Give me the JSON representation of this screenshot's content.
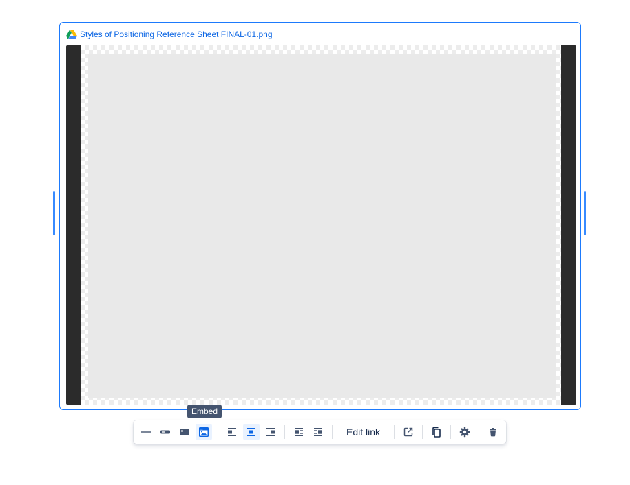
{
  "embed": {
    "title": "Styles of Positioning Reference Sheet FINAL-01.png",
    "provider_icon": "google-drive-icon"
  },
  "tooltip": {
    "text": "Embed"
  },
  "toolbar": {
    "view_buttons": [
      {
        "icon": "url-view-icon",
        "selected": false
      },
      {
        "icon": "inline-view-icon",
        "selected": false
      },
      {
        "icon": "card-view-icon",
        "selected": false
      },
      {
        "icon": "embed-view-icon",
        "selected": true
      }
    ],
    "align_buttons": [
      {
        "icon": "align-left-icon",
        "selected": false
      },
      {
        "icon": "align-center-icon",
        "selected": true
      },
      {
        "icon": "align-right-icon",
        "selected": false
      }
    ],
    "wrap_buttons": [
      {
        "icon": "wrap-left-icon",
        "selected": false
      },
      {
        "icon": "wrap-right-icon",
        "selected": false
      }
    ],
    "edit_link_label": "Edit link",
    "action_buttons": [
      {
        "icon": "open-link-icon"
      },
      {
        "icon": "copy-icon"
      },
      {
        "icon": "settings-icon"
      },
      {
        "icon": "delete-icon"
      }
    ],
    "colors": {
      "icon": "#44546f",
      "icon_selected": "#0c66e4",
      "selected_bg": "#e9f2ff",
      "accent_border": "#1d7afc"
    }
  }
}
